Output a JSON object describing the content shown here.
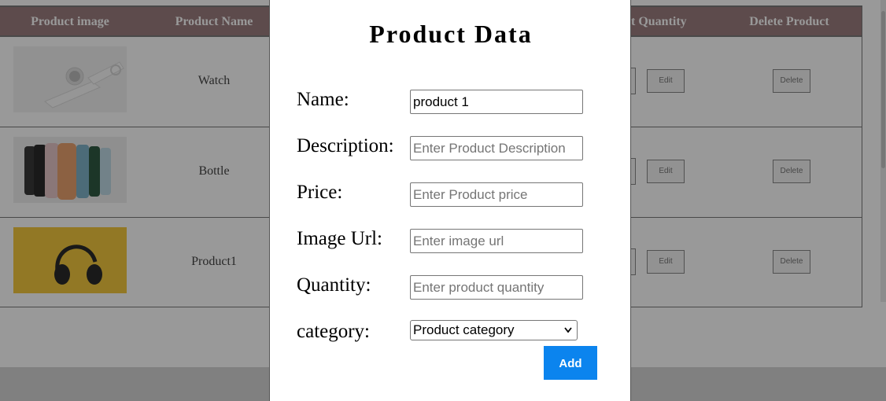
{
  "table": {
    "headers": {
      "image": "Product image",
      "name": "Product Name",
      "quantity": "t Quantity",
      "delete": "Delete Product"
    },
    "rows": [
      {
        "name": "Watch",
        "edit_label": "Edit",
        "delete_label": "Delete",
        "image_icon": "watch-image"
      },
      {
        "name": "Bottle",
        "edit_label": "Edit",
        "delete_label": "Delete",
        "image_icon": "bottles-image"
      },
      {
        "name": "Product1",
        "edit_label": "Edit",
        "delete_label": "Delete",
        "image_icon": "headphones-image"
      }
    ]
  },
  "modal": {
    "title": "Product Data",
    "fields": {
      "name": {
        "label": "Name:",
        "value": "product 1",
        "placeholder": ""
      },
      "description": {
        "label": "Description:",
        "value": "",
        "placeholder": "Enter Product Description"
      },
      "price": {
        "label": "Price:",
        "value": "",
        "placeholder": "Enter Product price"
      },
      "image_url": {
        "label": "Image Url:",
        "value": "",
        "placeholder": "Enter image url"
      },
      "quantity": {
        "label": "Quantity:",
        "value": "",
        "placeholder": "Enter product quantity"
      },
      "category": {
        "label": "category:",
        "selected": "Product category"
      }
    },
    "add_label": "Add"
  },
  "colors": {
    "header_bg": "#9b7d7f",
    "add_button": "#0b84ee",
    "overlay": "rgba(0,0,0,0.4)"
  }
}
